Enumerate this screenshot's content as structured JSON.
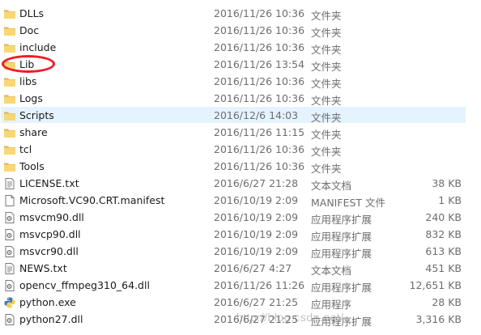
{
  "files": [
    {
      "name": "DLLs",
      "date": "2016/11/26 10:36",
      "type": "文件夹",
      "size": "",
      "icon": "folder-icon"
    },
    {
      "name": "Doc",
      "date": "2016/11/26 10:36",
      "type": "文件夹",
      "size": "",
      "icon": "folder-icon"
    },
    {
      "name": "include",
      "date": "2016/11/26 10:36",
      "type": "文件夹",
      "size": "",
      "icon": "folder-icon"
    },
    {
      "name": "Lib",
      "date": "2016/11/26 13:54",
      "type": "文件夹",
      "size": "",
      "icon": "folder-icon"
    },
    {
      "name": "libs",
      "date": "2016/11/26 10:36",
      "type": "文件夹",
      "size": "",
      "icon": "folder-icon"
    },
    {
      "name": "Logs",
      "date": "2016/11/26 10:36",
      "type": "文件夹",
      "size": "",
      "icon": "folder-icon"
    },
    {
      "name": "Scripts",
      "date": "2016/12/6 14:03",
      "type": "文件夹",
      "size": "",
      "icon": "folder-icon"
    },
    {
      "name": "share",
      "date": "2016/11/26 11:15",
      "type": "文件夹",
      "size": "",
      "icon": "folder-icon"
    },
    {
      "name": "tcl",
      "date": "2016/11/26 10:36",
      "type": "文件夹",
      "size": "",
      "icon": "folder-icon"
    },
    {
      "name": "Tools",
      "date": "2016/11/26 10:36",
      "type": "文件夹",
      "size": "",
      "icon": "folder-icon"
    },
    {
      "name": "LICENSE.txt",
      "date": "2016/6/27 21:28",
      "type": "文本文档",
      "size": "38 KB",
      "icon": "text-file-icon"
    },
    {
      "name": "Microsoft.VC90.CRT.manifest",
      "date": "2016/10/19 2:09",
      "type": "MANIFEST 文件",
      "size": "1 KB",
      "icon": "blank-file-icon"
    },
    {
      "name": "msvcm90.dll",
      "date": "2016/10/19 2:09",
      "type": "应用程序扩展",
      "size": "240 KB",
      "icon": "dll-file-icon"
    },
    {
      "name": "msvcp90.dll",
      "date": "2016/10/19 2:09",
      "type": "应用程序扩展",
      "size": "832 KB",
      "icon": "dll-file-icon"
    },
    {
      "name": "msvcr90.dll",
      "date": "2016/10/19 2:09",
      "type": "应用程序扩展",
      "size": "613 KB",
      "icon": "dll-file-icon"
    },
    {
      "name": "NEWS.txt",
      "date": "2016/6/27 4:27",
      "type": "文本文档",
      "size": "451 KB",
      "icon": "text-file-icon"
    },
    {
      "name": "opencv_ffmpeg310_64.dll",
      "date": "2016/11/26 11:26",
      "type": "应用程序扩展",
      "size": "12,651 KB",
      "icon": "dll-file-icon"
    },
    {
      "name": "python.exe",
      "date": "2016/6/27 21:25",
      "type": "应用程序",
      "size": "28 KB",
      "icon": "python-icon"
    },
    {
      "name": "python27.dll",
      "date": "2016/6/27 21:25",
      "type": "应用程序扩展",
      "size": "3,316 KB",
      "icon": "dll-file-icon"
    }
  ],
  "selected_index": 6,
  "annotation": {
    "target": "Lib",
    "color": "#ee1c25"
  },
  "watermark": "http://blog.csdn.net/..."
}
